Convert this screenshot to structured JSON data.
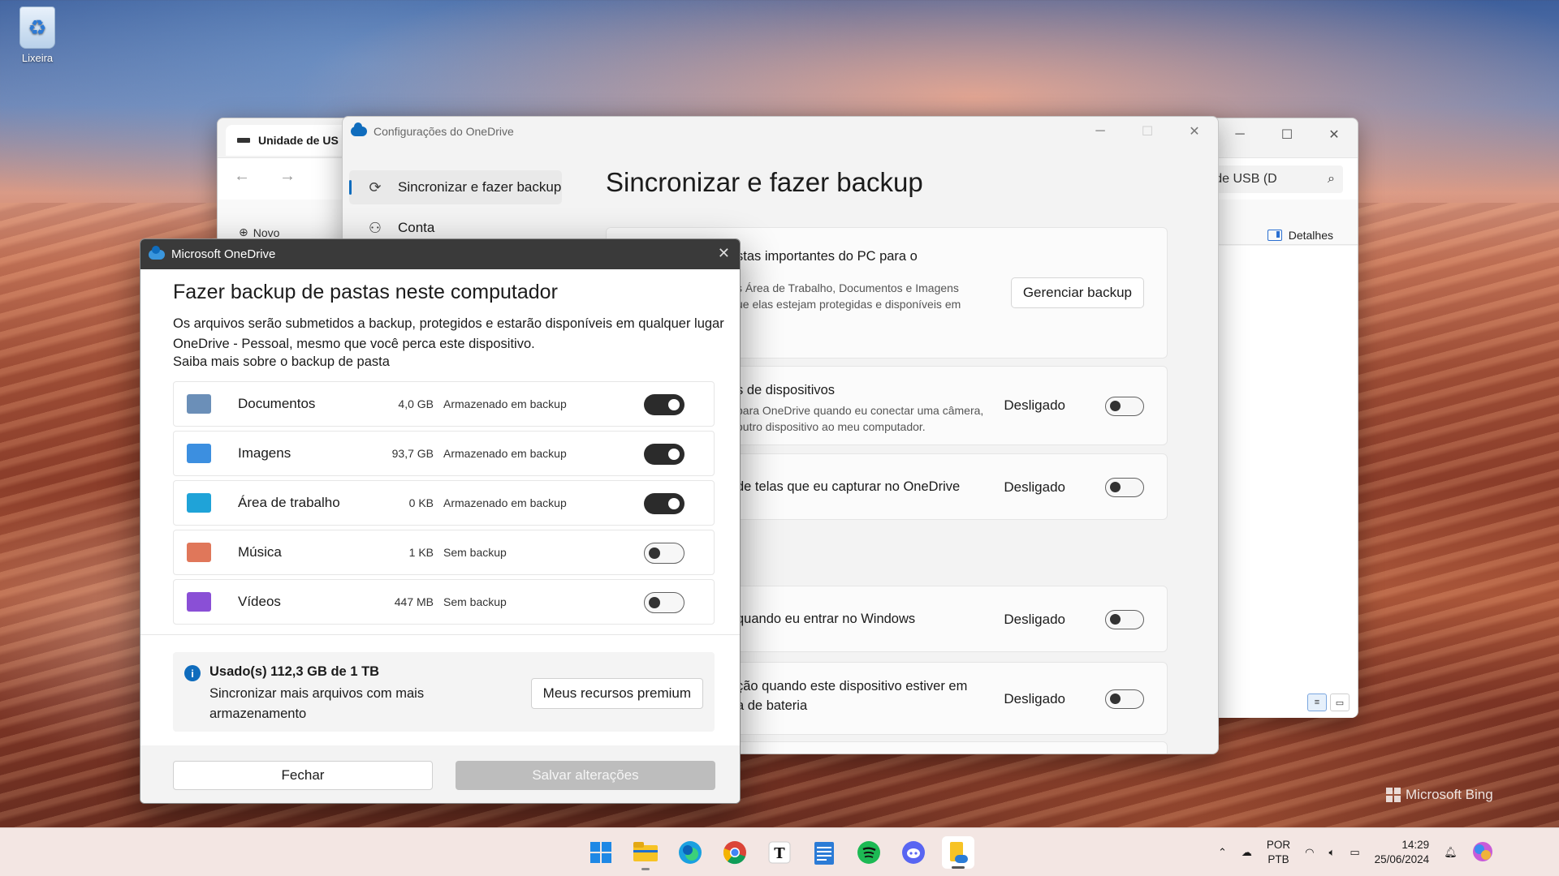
{
  "desktop": {
    "recycle_bin_label": "Lixeira",
    "watermark": "Microsoft Bing"
  },
  "explorer": {
    "tab_title": "Unidade de US",
    "address": "de de USB (D",
    "new_label": "Novo",
    "details_label": "Detalhes"
  },
  "settings": {
    "window_title": "Configurações do OneDrive",
    "nav": [
      {
        "label": "Sincronizar e fazer backup",
        "active": true
      },
      {
        "label": "Conta",
        "active": false
      }
    ],
    "heading": "Sincronizar e fazer backup",
    "backup_card": {
      "title": "stas importantes do PC para o",
      "sub1": "s Área de Trabalho, Documentos e Imagens",
      "sub2": "ue elas estejam protegidas e disponíveis em",
      "button": "Gerenciar backup"
    },
    "rows": [
      {
        "title": "s de dispositivos",
        "sub1": "para OneDrive quando eu conectar uma câmera,",
        "sub2": "outro dispositivo ao meu computador.",
        "state": "Desligado"
      },
      {
        "title": "de telas que eu capturar no OneDrive",
        "state": "Desligado"
      },
      {
        "title": "quando eu entrar no Windows",
        "state": "Desligado"
      },
      {
        "title": "ção quando este dispositivo estiver em",
        "title2": "a de bateria",
        "state": "Desligado"
      }
    ]
  },
  "dialog": {
    "window_title": "Microsoft OneDrive",
    "heading": "Fazer backup de pastas neste computador",
    "description": "Os arquivos serão submetidos a backup, protegidos e estarão disponíveis em qualquer lugar OneDrive  - Pessoal, mesmo que você perca este dispositivo.",
    "learn_more": "Saiba mais sobre o backup de pasta",
    "folders": [
      {
        "name": "Documentos",
        "size": "4,0 GB",
        "status": "Armazenado em backup",
        "on": true,
        "icon": "documents-folder-icon",
        "color": "#6b8fb8"
      },
      {
        "name": "Imagens",
        "size": "93,7 GB",
        "status": "Armazenado em backup",
        "on": true,
        "icon": "pictures-folder-icon",
        "color": "#3c8fe0"
      },
      {
        "name": "Área de trabalho",
        "size": "0 KB",
        "status": "Armazenado em backup",
        "on": true,
        "icon": "desktop-folder-icon",
        "color": "#1fa3d8"
      },
      {
        "name": "Música",
        "size": "1 KB",
        "status": "Sem backup",
        "on": false,
        "icon": "music-folder-icon",
        "color": "#e0775a"
      },
      {
        "name": "Vídeos",
        "size": "447 MB",
        "status": "Sem backup",
        "on": false,
        "icon": "videos-folder-icon",
        "color": "#8a4fd6"
      }
    ],
    "storage": {
      "used": "Usado(s) 112,3 GB de 1 TB",
      "more": "Sincronizar mais arquivos com mais armazenamento",
      "premium_button": "Meus recursos premium"
    },
    "close_button": "Fechar",
    "save_button": "Salvar alterações"
  },
  "taskbar": {
    "apps": [
      "start-icon",
      "file-explorer-icon",
      "edge-icon",
      "chrome-icon",
      "typora-icon",
      "notepad-icon",
      "spotify-icon",
      "discord-icon",
      "onedrive-setup-icon"
    ],
    "lang_top": "POR",
    "lang_bottom": "PTB",
    "time": "14:29",
    "date": "25/06/2024"
  }
}
